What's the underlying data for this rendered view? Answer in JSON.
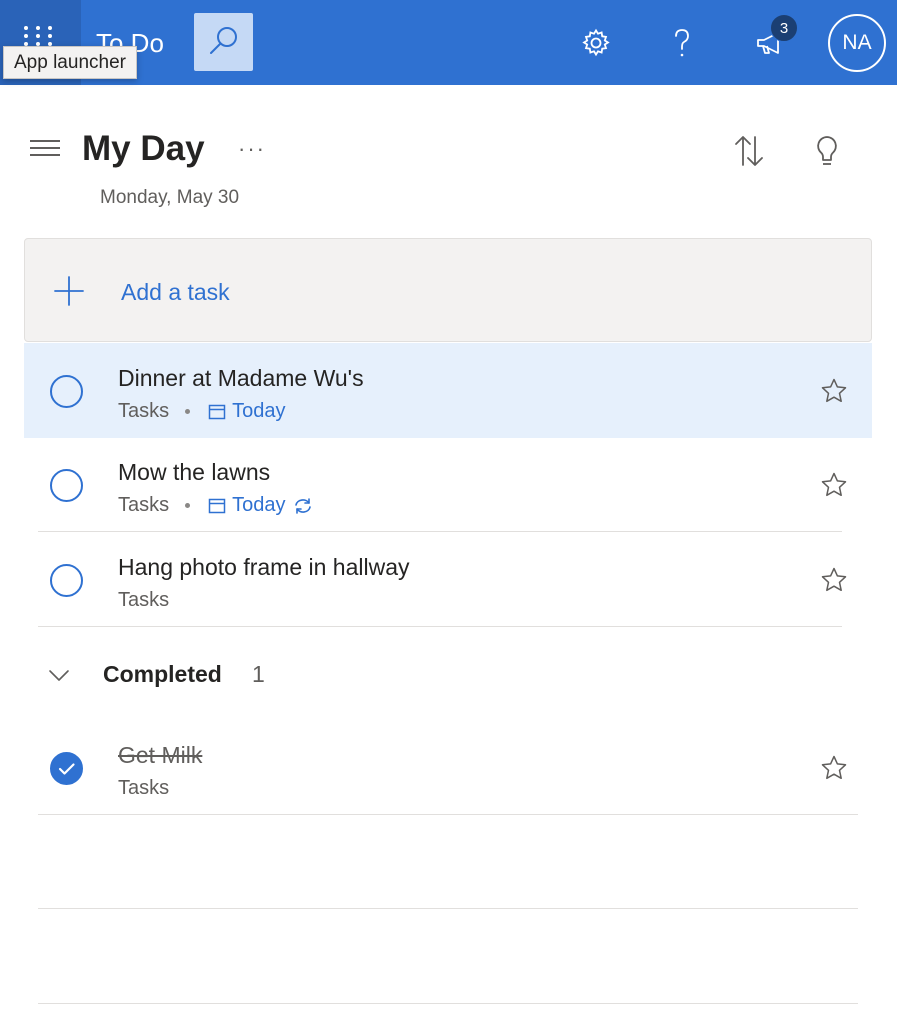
{
  "app": {
    "title": "To Do",
    "launcher_tooltip": "App launcher",
    "notification_count": "3",
    "avatar_initials": "NA",
    "accent_color": "#2f71d1"
  },
  "icons": {
    "launcher": "waffle-grid-icon",
    "search": "search-icon",
    "settings": "gear-icon",
    "help": "question-mark-icon",
    "whats_new": "megaphone-icon",
    "menu": "hamburger-icon",
    "more": "ellipsis-icon",
    "sort": "sort-arrows-icon",
    "suggestions": "lightbulb-icon",
    "add": "plus-icon",
    "due": "calendar-icon",
    "repeat": "repeat-icon",
    "importance": "star-icon",
    "collapse": "chevron-down-icon",
    "check": "checkmark-icon"
  },
  "list": {
    "title": "My Day",
    "more_label": "···",
    "date": "Monday, May 30"
  },
  "add_task": {
    "label": "Add a task"
  },
  "tasks": [
    {
      "title": "Dinner at Madame Wu's",
      "list": "Tasks",
      "due": "Today",
      "repeat": false,
      "selected": true,
      "completed": false
    },
    {
      "title": "Mow the lawns",
      "list": "Tasks",
      "due": "Today",
      "repeat": true,
      "selected": false,
      "completed": false
    },
    {
      "title": "Hang photo frame in hallway",
      "list": "Tasks",
      "due": "",
      "repeat": false,
      "selected": false,
      "completed": false
    }
  ],
  "completed": {
    "label": "Completed",
    "count": "1",
    "tasks": [
      {
        "title": "Get Milk",
        "list": "Tasks",
        "completed": true
      }
    ]
  }
}
